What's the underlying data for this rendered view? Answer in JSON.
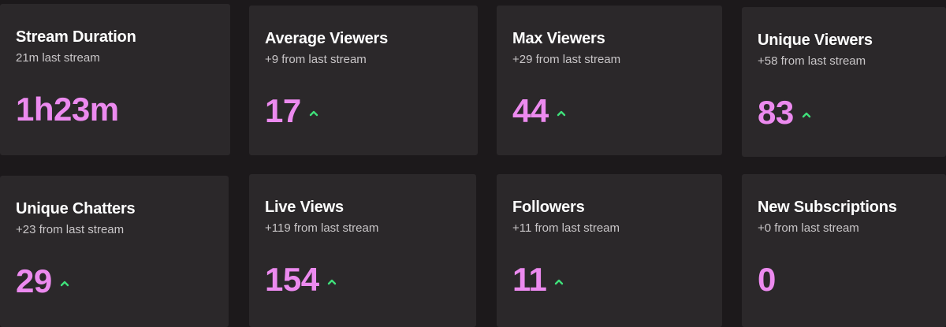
{
  "colors": {
    "background": "#1c191b",
    "card": "#2b282a",
    "value": "#ec8aef",
    "trend_up": "#3fe07a",
    "subtitle": "#c9c6c8"
  },
  "stats": [
    {
      "title": "Stream Duration",
      "subtitle": "21m last stream",
      "value": "1h23m",
      "trend_icon": ""
    },
    {
      "title": "Average Viewers",
      "subtitle": "+9 from last stream",
      "value": "17",
      "trend_icon": "caret-up-icon"
    },
    {
      "title": "Max Viewers",
      "subtitle": "+29 from last stream",
      "value": "44",
      "trend_icon": "caret-up-icon"
    },
    {
      "title": "Unique Viewers",
      "subtitle": "+58 from last stream",
      "value": "83",
      "trend_icon": "caret-up-icon"
    },
    {
      "title": "Unique Chatters",
      "subtitle": "+23 from last stream",
      "value": "29",
      "trend_icon": "caret-up-icon"
    },
    {
      "title": "Live Views",
      "subtitle": "+119 from last stream",
      "value": "154",
      "trend_icon": "caret-up-icon"
    },
    {
      "title": "Followers",
      "subtitle": "+11 from last stream",
      "value": "11",
      "trend_icon": "caret-up-icon"
    },
    {
      "title": "New Subscriptions",
      "subtitle": "+0 from last stream",
      "value": "0",
      "trend_icon": ""
    }
  ]
}
